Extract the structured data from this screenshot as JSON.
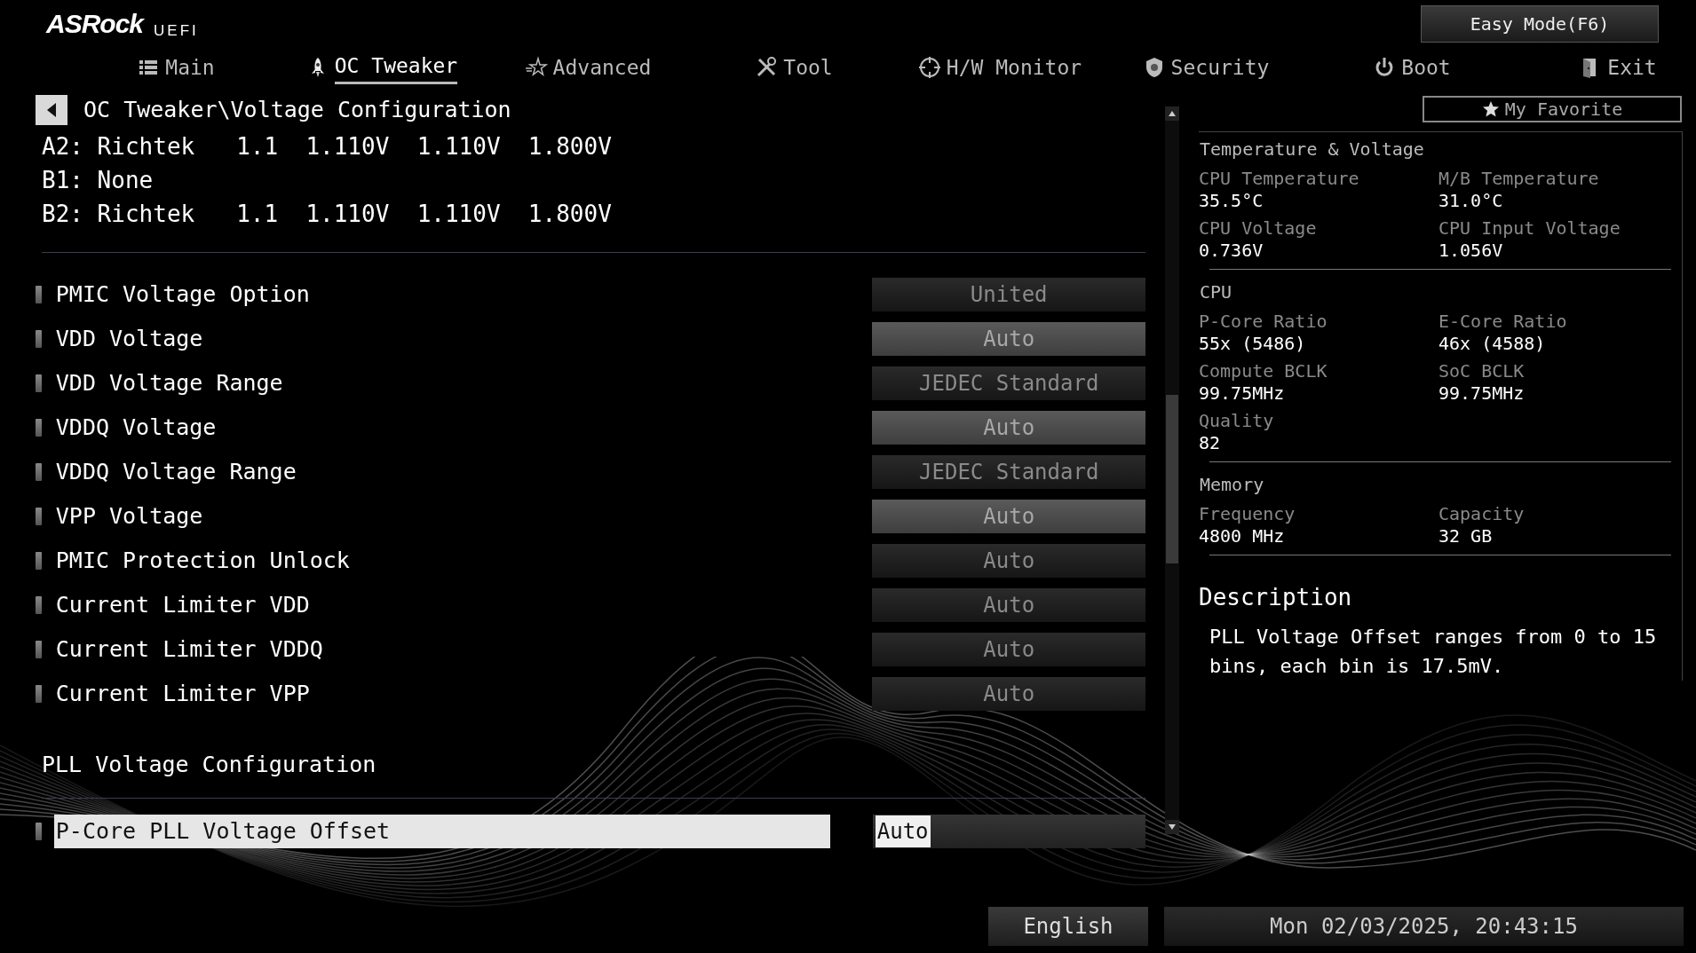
{
  "brand": {
    "logo": "ASRock",
    "suffix": "UEFI"
  },
  "easy_mode_button": "Easy Mode(F6)",
  "tabs": [
    {
      "label": "Main",
      "selected": false
    },
    {
      "label": "OC Tweaker",
      "selected": true
    },
    {
      "label": "Advanced",
      "selected": false
    },
    {
      "label": "Tool",
      "selected": false
    },
    {
      "label": "H/W Monitor",
      "selected": false
    },
    {
      "label": "Security",
      "selected": false
    },
    {
      "label": "Boot",
      "selected": false
    },
    {
      "label": "Exit",
      "selected": false
    }
  ],
  "breadcrumb": "OC Tweaker\\Voltage Configuration",
  "favorite_button": "My Favorite",
  "pmic_lines": [
    "A2: Richtek   1.1  1.110V  1.110V  1.800V",
    "B1: None",
    "B2: Richtek   1.1  1.110V  1.110V  1.800V"
  ],
  "settings": [
    {
      "label": "PMIC Voltage Option",
      "value": "United",
      "kind": "select",
      "disabled": true,
      "selected": false
    },
    {
      "label": "VDD  Voltage",
      "value": "Auto",
      "kind": "field",
      "disabled": true,
      "selected": false
    },
    {
      "label": "VDD  Voltage Range",
      "value": "JEDEC Standard",
      "kind": "select",
      "disabled": true,
      "selected": false
    },
    {
      "label": "VDDQ Voltage",
      "value": "Auto",
      "kind": "field",
      "disabled": true,
      "selected": false
    },
    {
      "label": "VDDQ Voltage Range",
      "value": "JEDEC Standard",
      "kind": "select",
      "disabled": true,
      "selected": false
    },
    {
      "label": "VPP  Voltage",
      "value": "Auto",
      "kind": "field",
      "disabled": true,
      "selected": false
    },
    {
      "label": "PMIC Protection Unlock",
      "value": "Auto",
      "kind": "select",
      "disabled": true,
      "selected": false
    },
    {
      "label": "Current Limiter VDD",
      "value": "Auto",
      "kind": "select",
      "disabled": true,
      "selected": false
    },
    {
      "label": "Current Limiter VDDQ",
      "value": "Auto",
      "kind": "select",
      "disabled": true,
      "selected": false
    },
    {
      "label": "Current Limiter VPP",
      "value": "Auto",
      "kind": "select",
      "disabled": true,
      "selected": false
    }
  ],
  "pll_section": {
    "title": "PLL Voltage Configuration",
    "settings": [
      {
        "label": "P-Core PLL Voltage Offset",
        "value": "Auto",
        "kind": "field",
        "disabled": false,
        "selected": true
      }
    ]
  },
  "monitor": {
    "sections": [
      {
        "title": "Temperature & Voltage",
        "items": [
          {
            "label": "CPU Temperature",
            "value": "35.5°C"
          },
          {
            "label": "M/B Temperature",
            "value": "31.0°C"
          },
          {
            "label": "CPU Voltage",
            "value": "0.736V"
          },
          {
            "label": "CPU Input Voltage",
            "value": "1.056V"
          }
        ]
      },
      {
        "title": "CPU",
        "items": [
          {
            "label": "P-Core Ratio",
            "value": "55x (5486)"
          },
          {
            "label": "E-Core Ratio",
            "value": "46x (4588)"
          },
          {
            "label": "Compute BCLK",
            "value": "99.75MHz"
          },
          {
            "label": "SoC BCLK",
            "value": "99.75MHz"
          },
          {
            "label": "Quality",
            "value": "82"
          }
        ]
      },
      {
        "title": "Memory",
        "items": [
          {
            "label": "Frequency",
            "value": "4800 MHz"
          },
          {
            "label": "Capacity",
            "value": "32 GB"
          }
        ]
      }
    ]
  },
  "description": {
    "title": "Description",
    "text": "PLL Voltage Offset ranges from 0 to 15 bins, each bin is 17.5mV."
  },
  "language_button": "English",
  "datetime": "Mon 02/03/2025, 20:43:15"
}
